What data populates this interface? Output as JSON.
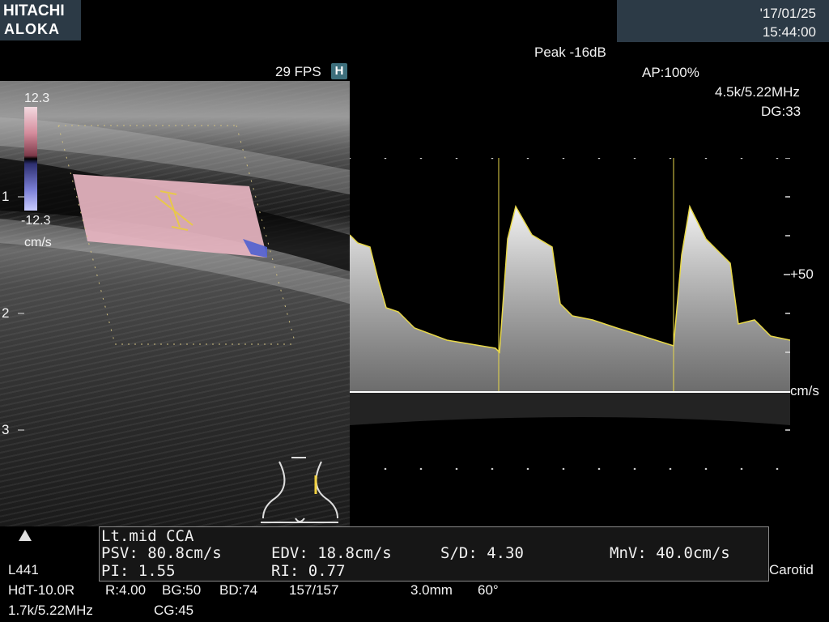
{
  "header": {
    "brand_line1": "HITACHI",
    "brand_line2": "ALOKA",
    "date": "'17/01/25",
    "time": "15:44:00",
    "peak": "Peak -16dB",
    "ap": "AP:100%",
    "doppler_freq": "4.5k/5.22MHz",
    "dg": "DG:33"
  },
  "bmode": {
    "fps": "29 FPS",
    "badge": "H",
    "scale_top": "12.3",
    "scale_bottom": "-12.3",
    "scale_unit": "cm/s",
    "depth_labels": [
      "1",
      "2",
      "3"
    ]
  },
  "spectral": {
    "scale_label": "+50",
    "unit": "cm/s"
  },
  "measurement": {
    "vessel": "Lt.mid CCA",
    "psv": "PSV: 80.8cm/s",
    "edv": "EDV: 18.8cm/s",
    "sd": "S/D: 4.30",
    "mnv": "MnV: 40.0cm/s",
    "pi": "PI:  1.55",
    "ri": "RI:  0.77"
  },
  "footer": {
    "probe": "L441",
    "preset": "Carotid",
    "line2_a": "HdT-10.0R",
    "line2_b": "R:4.00",
    "line2_c": "BG:50",
    "line2_d": "BD:74",
    "line2_e": "157/157",
    "line2_f": "3.0mm",
    "line2_g": "60°",
    "line3_a": "1.7k/5.22MHz",
    "line3_b": "CG:45"
  },
  "colors": {
    "panel_bg": "#2c3a46",
    "trace": "#e8d84a",
    "color_box": "#e7b5c1"
  }
}
